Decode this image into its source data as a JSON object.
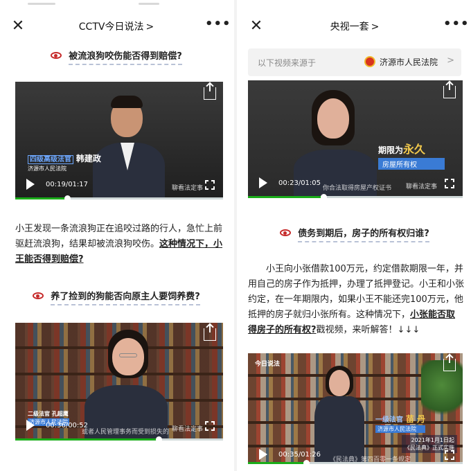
{
  "left": {
    "title": "CCTV今日说法",
    "heading1": "被流浪狗咬伤能否得到赔偿?",
    "video1": {
      "time": "00:19",
      "duration": "/01:17",
      "progress": 0.25,
      "name_title": "四级高级法官",
      "name": "韩建政",
      "org": "济源市人民法院",
      "watermark": "聊看法定事"
    },
    "paragraph_plain": "小王发现一条流浪狗正在追咬过路的行人，急忙上前驱赶流浪狗，结果却被流浪狗咬伤。",
    "paragraph_emph": "这种情况下，小王能否得到赔偿?",
    "heading2": "养了捡到的狗能否向原主人要饲养费?",
    "video2": {
      "time": "00:36",
      "duration": "/00:52",
      "progress": 0.69,
      "name_title": "二级法官",
      "name": "孔超鹰",
      "org": "济源市人民法院",
      "subtitle": "或者人民管理事务而受到损失的",
      "watermark": "聊看法定事"
    }
  },
  "right": {
    "title": "央视一套",
    "source_label": "以下视频来源于",
    "source_name": "济源市人民法院",
    "video1": {
      "time": "00:23",
      "duration": "/01:05",
      "progress": 0.35,
      "caption_prefix": "期限为",
      "caption_big": "永久",
      "caption_sub": "房屋所有权",
      "subtitle": "你合法取得房屋产权证书",
      "watermark": "聊看法定事"
    },
    "heading": "债务到期后，房子的所有权归谁?",
    "paragraph_plain": "小王向小张借款100万元，约定借款期限一年，并用自己的房子作为抵押，办理了抵押登记。小王和小张约定，在一年期限内，如果小王不能还完100万元，他抵押的房子就归小张所有。这种情况下，",
    "paragraph_emph": "小张能否取得房子的所有权?",
    "paragraph_tail": "戳视频，来听解答！↓↓↓",
    "video2": {
      "time": "00:35",
      "duration": "/01:26",
      "progress": 0.27,
      "tag": "今日说法",
      "name_title": "一级法官",
      "name": "苗  丹",
      "org": "济源市人民法院",
      "law_line1": "2021年1月1日起",
      "law_line2": "《民法典》正式实施",
      "subtitle": "《民法典》第四百零一条规定"
    }
  },
  "colors": {
    "progress": "#1aad19",
    "eye": "#c62a2a",
    "nameplate_blue": "#3a7bd5"
  }
}
